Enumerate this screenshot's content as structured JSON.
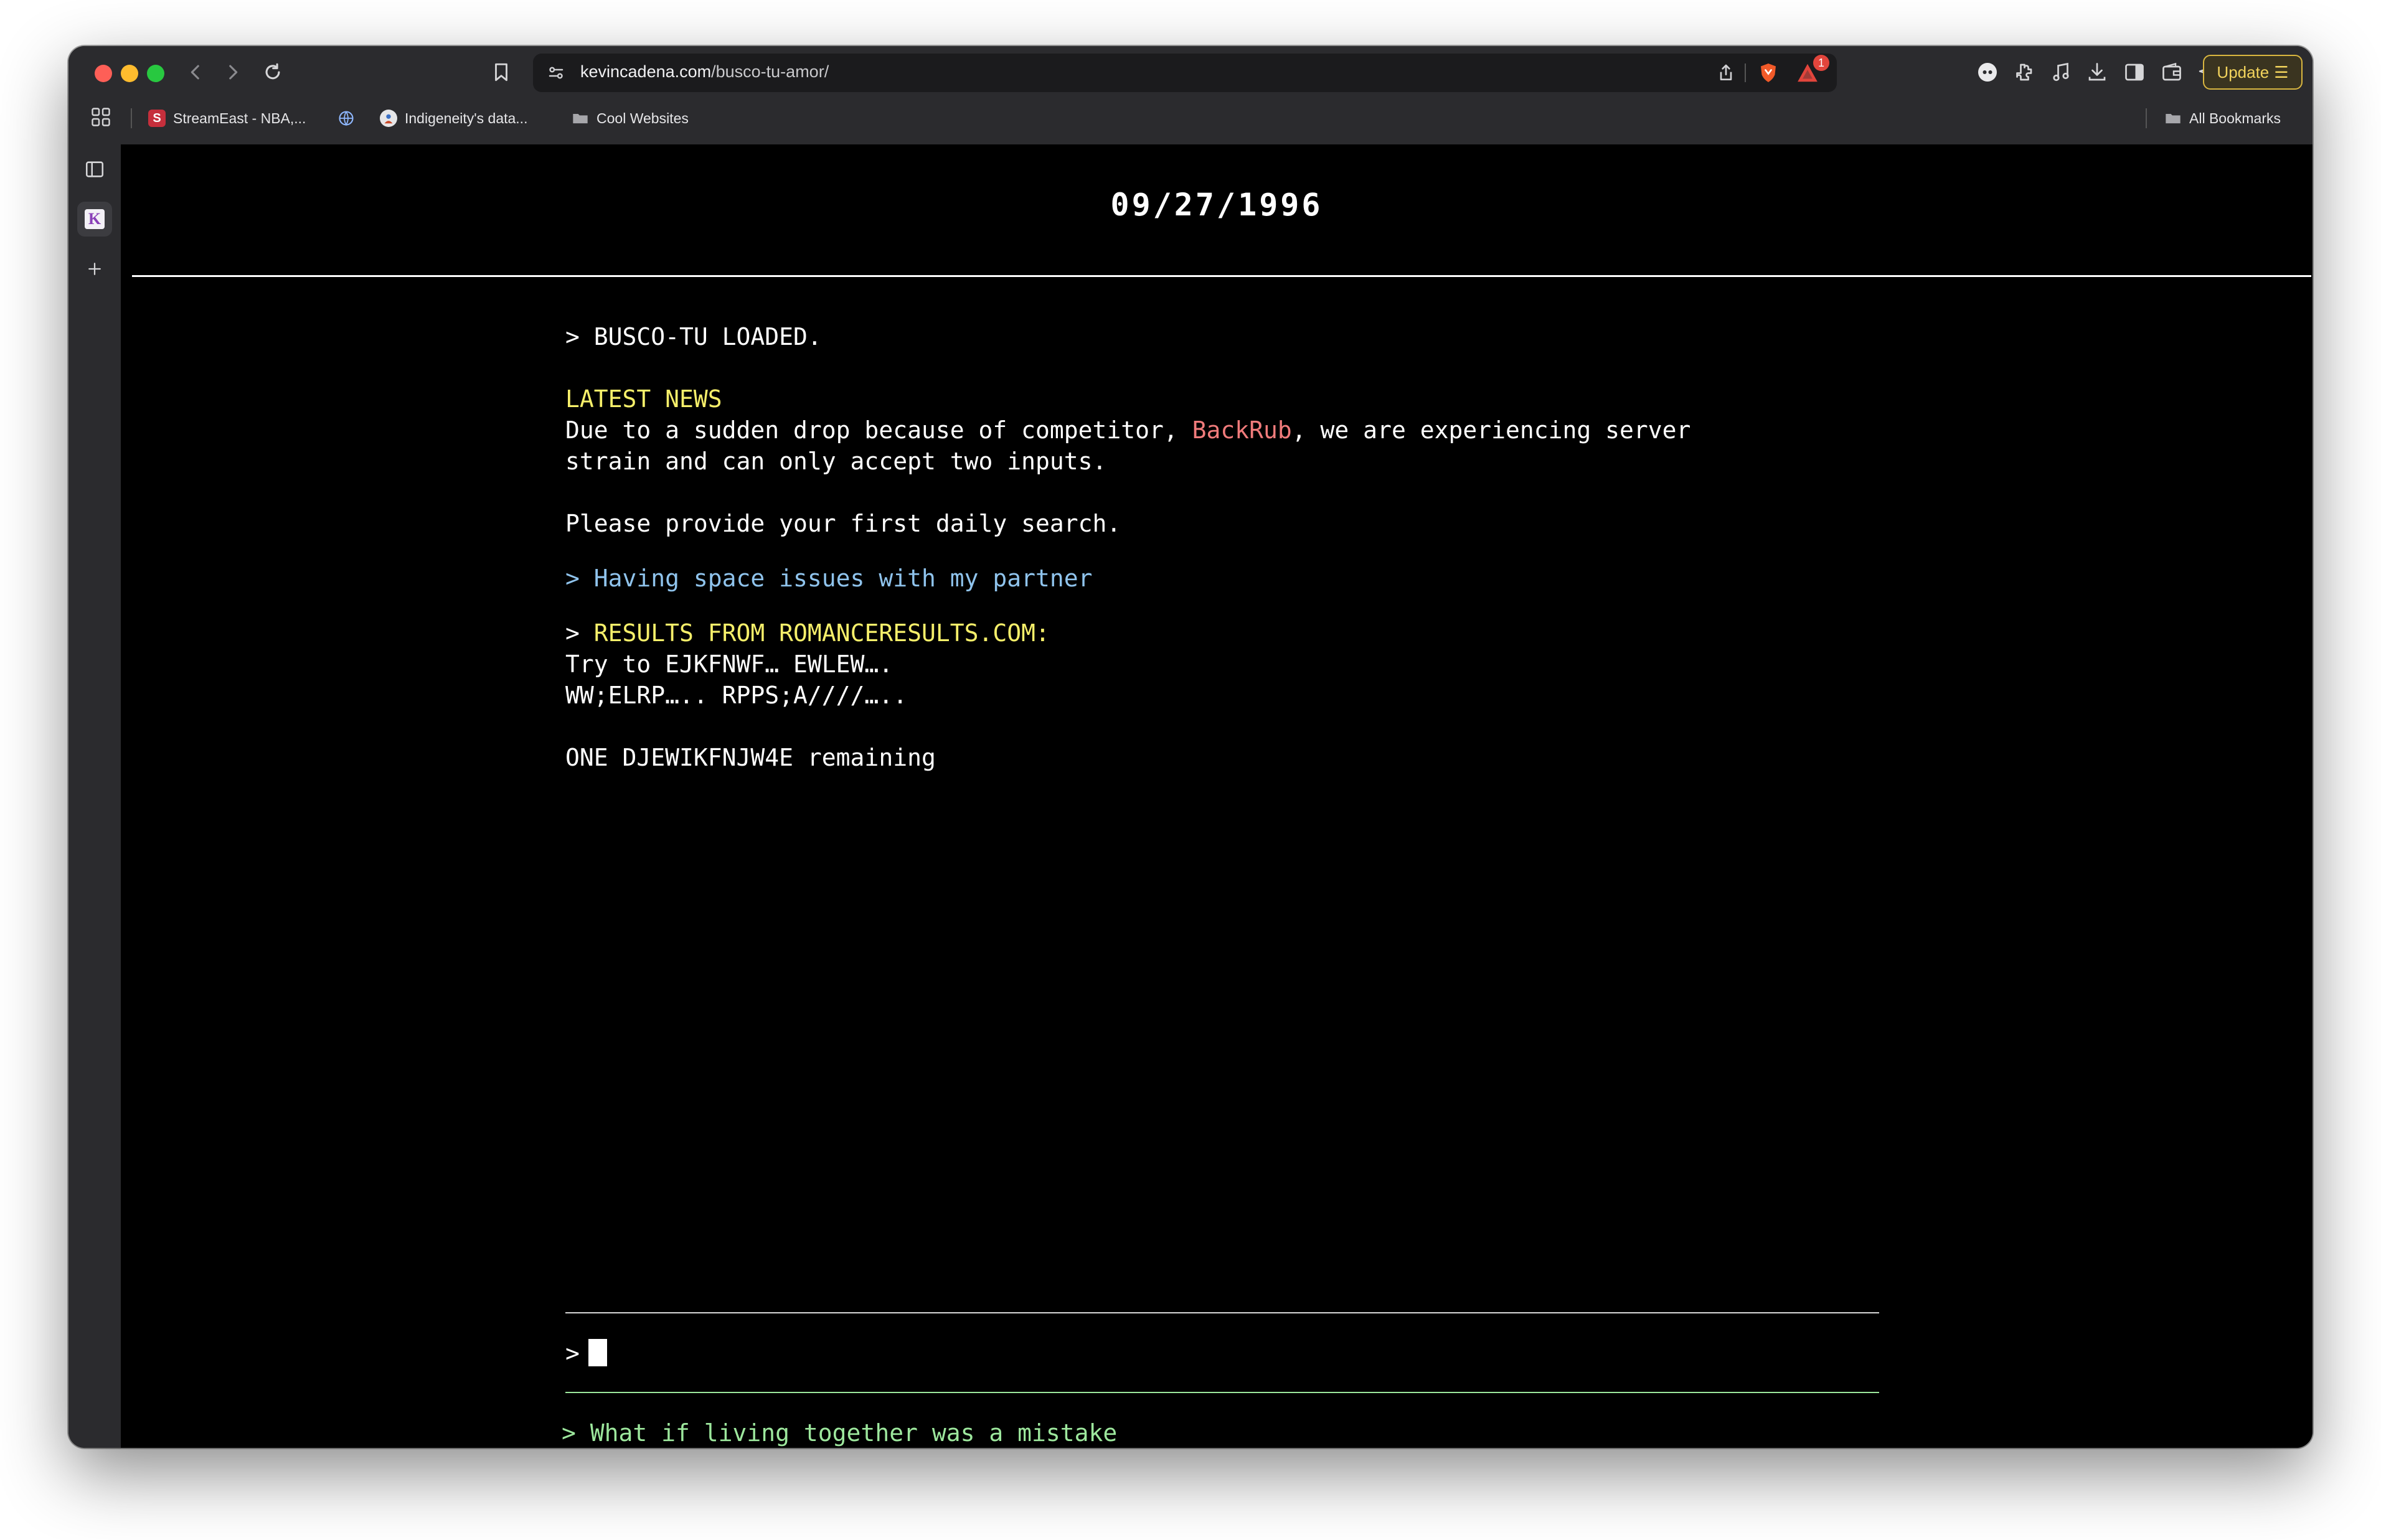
{
  "browser": {
    "url_domain": "kevincadena.com",
    "url_path": "/busco-tu-amor/",
    "update_label": "Update",
    "alert_count": "1",
    "bookmarks": [
      {
        "label": "StreamEast - NBA,...",
        "icon": "S"
      },
      {
        "label": "Indigeneity's data..."
      },
      {
        "label": "Cool Websites"
      }
    ],
    "all_bookmarks_label": "All Bookmarks",
    "sidebar_app_letter": "K"
  },
  "page": {
    "date": "09/27/1996",
    "loaded_line": "> BUSCO-TU LOADED.",
    "news_heading": "LATEST NEWS",
    "news_text_1": "Due to a sudden drop because of competitor, ",
    "news_competitor": "BackRub",
    "news_text_2": ", we are experiencing server",
    "news_text_3": "strain and can only accept two inputs.",
    "prompt_text": "Please provide your first daily search.",
    "user_query": "> Having space issues with my partner",
    "results_prompt": "> ",
    "results_heading": "RESULTS FROM ROMANCERESULTS.COM:",
    "result_line_1": "Try to EJKFNWF… EWLEW….",
    "result_line_2": "WW;ELRP….. RPPS;A////…..",
    "remaining_text": "ONE DJEWIKFNJW4E remaining",
    "input_prompt": ">",
    "suggestion": "> What if living together was a mistake"
  },
  "colors": {
    "accent_yellow": "#f6ef6a",
    "competitor_red": "#f07b7b",
    "query_blue": "#8fc3ec",
    "suggestion_green": "#9de79d"
  }
}
